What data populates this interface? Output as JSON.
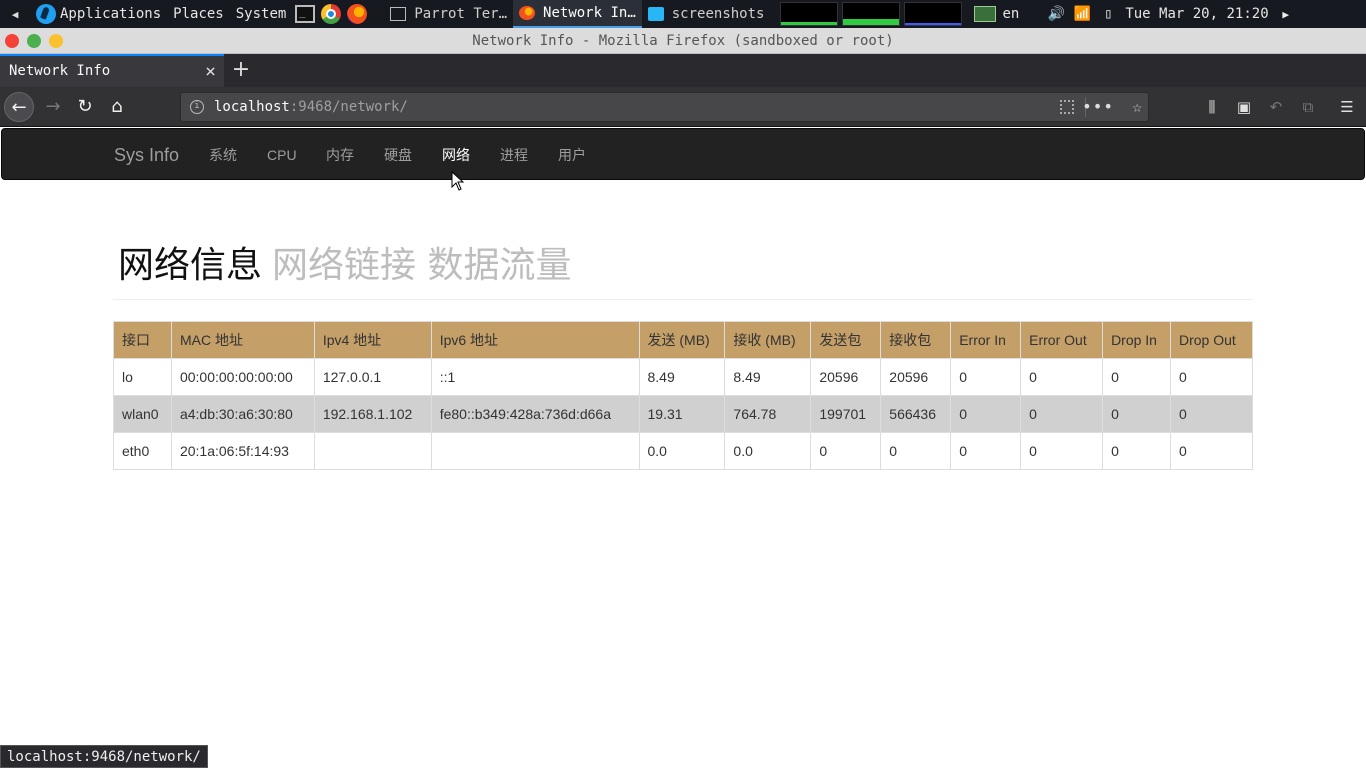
{
  "panel": {
    "menu": [
      "Applications",
      "Places",
      "System"
    ],
    "tasks": [
      "Parrot Ter…",
      "Network In…",
      "screenshots"
    ],
    "keyboard_layout": "en",
    "clock": "Tue Mar 20, 21:20"
  },
  "window": {
    "title": "Network Info - Mozilla Firefox (sandboxed or root)"
  },
  "tabs": [
    {
      "label": "Network Info",
      "active": true
    }
  ],
  "urlbar": {
    "host": "localhost",
    "path": ":9468/network/"
  },
  "site": {
    "brand": "Sys Info",
    "nav": [
      "系统",
      "CPU",
      "内存",
      "硬盘",
      "网络",
      "进程",
      "用户"
    ],
    "active_nav": "网络"
  },
  "heading": {
    "main": "网络信息",
    "sub": "网络链接 数据流量"
  },
  "table": {
    "headers": [
      "接口",
      "MAC 地址",
      "Ipv4 地址",
      "Ipv6 地址",
      "发送 (MB)",
      "接收 (MB)",
      "发送包",
      "接收包",
      "Error In",
      "Error Out",
      "Drop In",
      "Drop Out"
    ],
    "rows": [
      [
        "lo",
        "00:00:00:00:00:00",
        "127.0.0.1",
        "::1",
        "8.49",
        "8.49",
        "20596",
        "20596",
        "0",
        "0",
        "0",
        "0"
      ],
      [
        "wlan0",
        "a4:db:30:a6:30:80",
        "192.168.1.102",
        "fe80::b349:428a:736d:d66a",
        "19.31",
        "764.78",
        "199701",
        "566436",
        "0",
        "0",
        "0",
        "0"
      ],
      [
        "eth0",
        "20:1a:06:5f:14:93",
        "",
        "",
        "0.0",
        "0.0",
        "0",
        "0",
        "0",
        "0",
        "0",
        "0"
      ]
    ]
  },
  "statusbar": "localhost:9468/network/"
}
